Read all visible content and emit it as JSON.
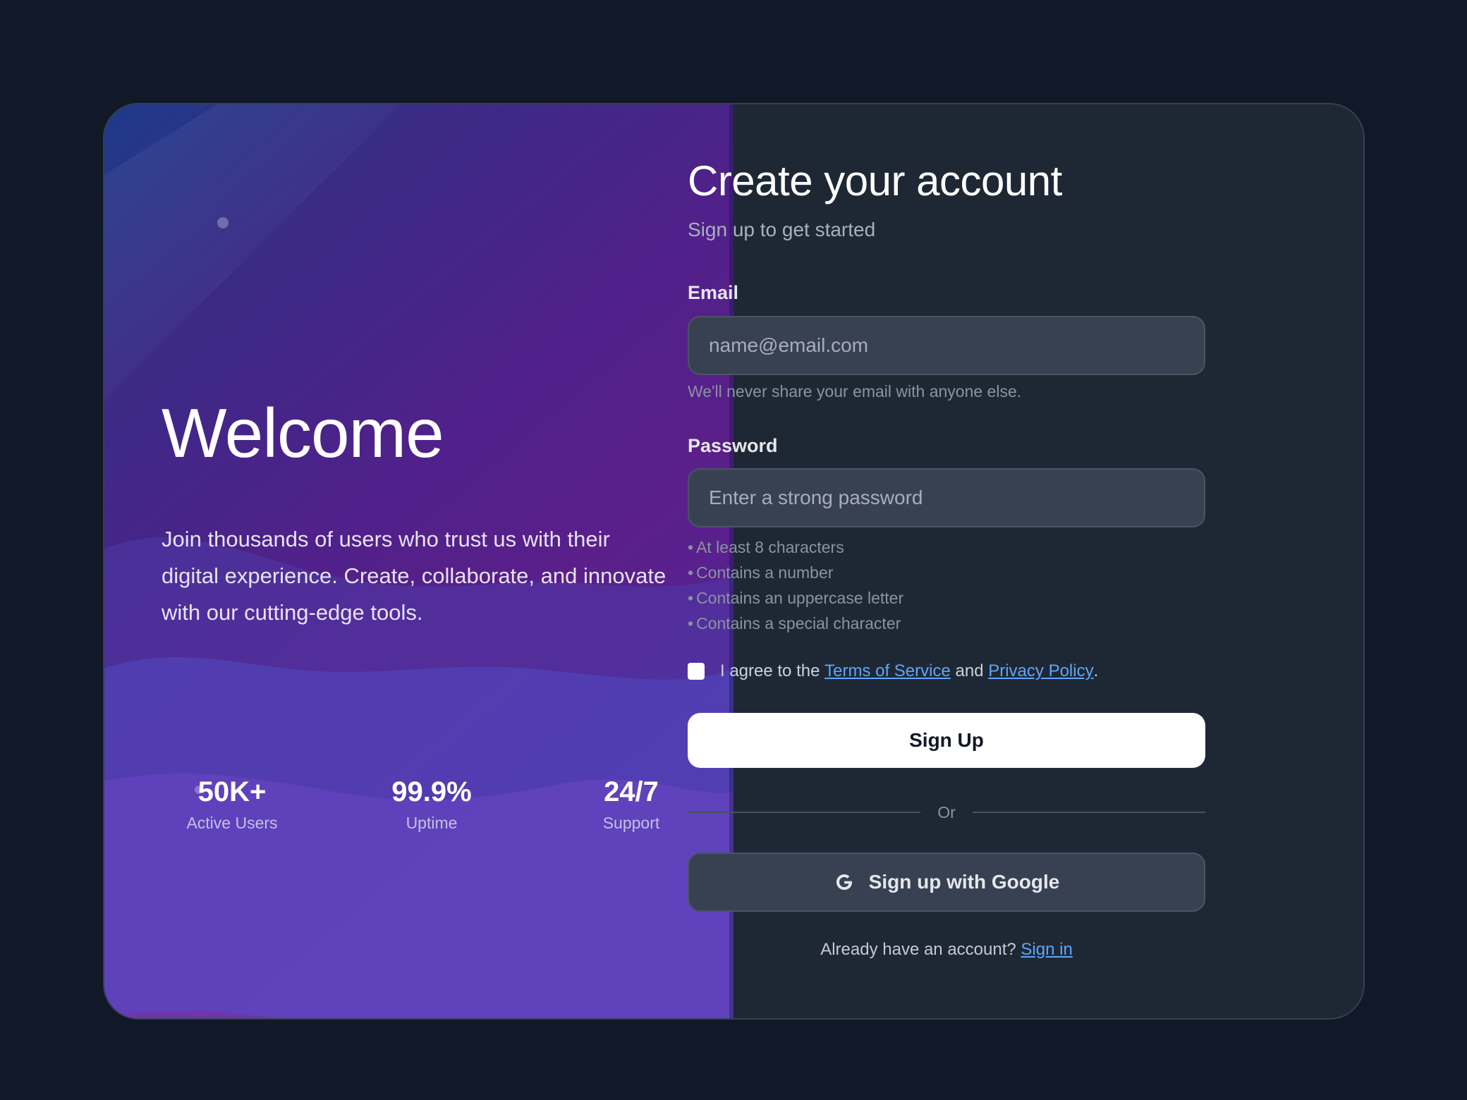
{
  "hero": {
    "title": "Welcome",
    "tagline": "Join thousands of users who trust us with their digital experience. Create, collaborate, and innovate with our cutting-edge tools.",
    "stats": [
      {
        "value": "50K+",
        "label": "Active Users"
      },
      {
        "value": "99.9%",
        "label": "Uptime"
      },
      {
        "value": "24/7",
        "label": "Support"
      }
    ]
  },
  "form": {
    "title": "Create your account",
    "subtitle": "Sign up to get started",
    "email": {
      "label": "Email",
      "placeholder": "name@email.com",
      "value": "",
      "hint": "We'll never share your email with anyone else."
    },
    "password": {
      "label": "Password",
      "placeholder": "Enter a strong password",
      "value": "",
      "rules": [
        "At least 8 characters",
        "Contains a number",
        "Contains an uppercase letter",
        "Contains a special character"
      ]
    },
    "agree": {
      "prefix": "I agree to the",
      "terms_link": "Terms of Service",
      "middle": "and",
      "privacy_link": "Privacy Policy",
      "suffix": ".",
      "checked": false
    },
    "submit_label": "Sign Up",
    "divider_label": "Or",
    "google_label": "Sign up with Google",
    "signin": {
      "prompt": "Already have an account?",
      "link": "Sign in"
    }
  },
  "colors": {
    "background": "#111827",
    "panel": "#1e2835",
    "input": "#374151",
    "accent_link": "#60a5fa",
    "hero_gradient_start": "#1e3a8a",
    "hero_gradient_mid": "#5a1f8a"
  },
  "icons": {
    "google": "google-g-icon"
  }
}
